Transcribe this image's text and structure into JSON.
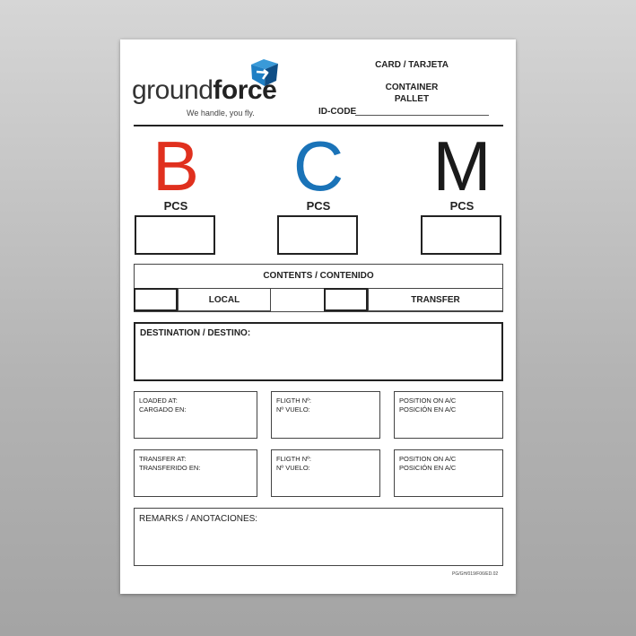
{
  "brand": {
    "name_light": "ground",
    "name_bold": "force",
    "tagline": "We handle, you fly."
  },
  "header": {
    "card_title": "CARD / TARJETA",
    "container": "CONTAINER",
    "pallet": "PALLET",
    "id_code_label": "ID-CODE"
  },
  "categories": [
    {
      "letter": "B",
      "color": "#e0301e",
      "pcs_label": "PCS"
    },
    {
      "letter": "C",
      "color": "#1a73b8",
      "pcs_label": "PCS"
    },
    {
      "letter": "M",
      "color": "#1a1a1a",
      "pcs_label": "PCS"
    }
  ],
  "contents": {
    "title": "CONTENTS / CONTENIDO",
    "options": [
      "LOCAL",
      "TRANSFER"
    ]
  },
  "destination_label": "DESTINATION / DESTINO:",
  "loaded_row": [
    {
      "line1": "LOADED AT:",
      "line2": "CARGADO EN:"
    },
    {
      "line1": "FLIGTH Nº:",
      "line2": "Nº VUELO:"
    },
    {
      "line1": "POSITION ON A/C",
      "line2": "POSICIÓN EN A/C"
    }
  ],
  "transfer_row": [
    {
      "line1": "TRANSFER AT:",
      "line2": "TRANSFERIDO EN:"
    },
    {
      "line1": "FLIGTH Nº:",
      "line2": "Nº VUELO:"
    },
    {
      "line1": "POSITION ON A/C",
      "line2": "POSICIÓN EN A/C"
    }
  ],
  "remarks_label": "REMARKS / ANOTACIONES:",
  "doc_code": "PG/GH/019/F06/ED.02",
  "colors": {
    "logo_blue": "#1f7fc4",
    "logo_dark": "#0f4e86"
  }
}
